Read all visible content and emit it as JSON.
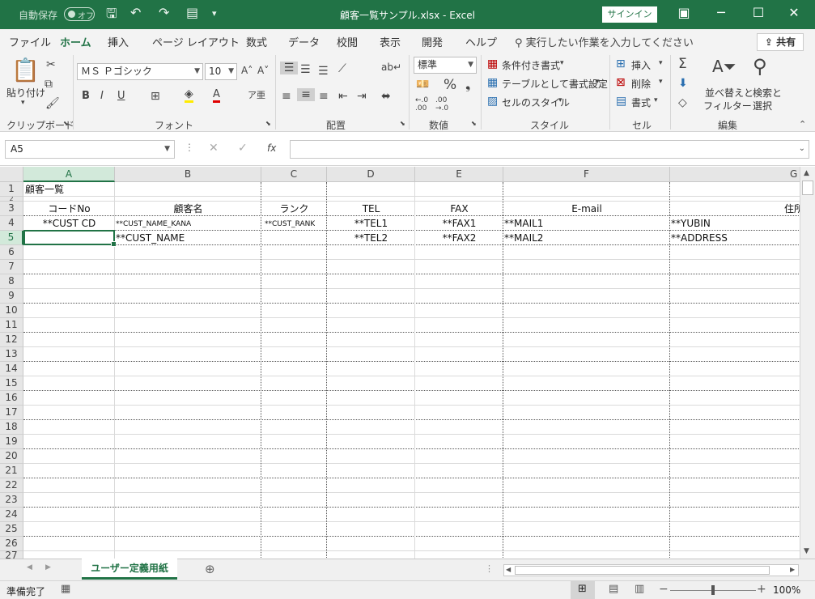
{
  "window": {
    "title": "顧客一覧サンプル.xlsx  -  Excel",
    "autosave_label": "自動保存",
    "autosave_state": "オフ",
    "signin_label": "サインイン"
  },
  "ribbon_tabs": [
    "ファイル",
    "ホーム",
    "挿入",
    "ページ レイアウト",
    "数式",
    "データ",
    "校閲",
    "表示",
    "開発",
    "ヘルプ"
  ],
  "tell_me": "実行したい作業を入力してください",
  "share_label": "共有",
  "ribbon": {
    "clipboard": {
      "paste_label": "貼り付け",
      "group": "クリップボード"
    },
    "font": {
      "name": "ＭＳ Ｐゴシック",
      "size": "10",
      "group": "フォント"
    },
    "alignment": {
      "group": "配置"
    },
    "number": {
      "format": "標準",
      "group": "数値"
    },
    "styles": {
      "conditional": "条件付き書式",
      "as_table": "テーブルとして書式設定",
      "cell_styles": "セルのスタイル",
      "group": "スタイル"
    },
    "cells": {
      "insert": "挿入",
      "delete": "削除",
      "format": "書式",
      "group": "セル"
    },
    "editing": {
      "sort_line1": "並べ替えと",
      "sort_line2": "フィルター",
      "find_line1": "検索と",
      "find_line2": "選択",
      "group": "編集"
    }
  },
  "formula_bar": {
    "name_box": "A5",
    "fx": "fx",
    "formula": ""
  },
  "columns": [
    "A",
    "B",
    "C",
    "D",
    "E",
    "F",
    "G"
  ],
  "rows": [
    "1",
    "2",
    "3",
    "4",
    "5",
    "6",
    "7",
    "8",
    "9",
    "10",
    "11",
    "12",
    "13",
    "14",
    "15",
    "16",
    "17",
    "18",
    "19",
    "20",
    "21",
    "22",
    "23",
    "24",
    "25",
    "26",
    "27"
  ],
  "cells": {
    "A1": "顧客一覧",
    "A3": "コードNo",
    "B3": "顧客名",
    "C3": "ランク",
    "D3": "TEL",
    "E3": "FAX",
    "F3": "E-mail",
    "G3": "住所",
    "A4": "**CUST CD",
    "B4": "**CUST_NAME_KANA",
    "C4": "**CUST_RANK",
    "D4": "**TEL1",
    "E4": "**FAX1",
    "F4": "**MAIL1",
    "G4": "**YUBIN",
    "B5": "**CUST_NAME",
    "D5": "**TEL2",
    "E5": "**FAX2",
    "F5": "**MAIL2",
    "G5": "**ADDRESS"
  },
  "sheet_tab": "ユーザー定義用紙",
  "status": {
    "text": "準備完了",
    "zoom": "100%"
  }
}
